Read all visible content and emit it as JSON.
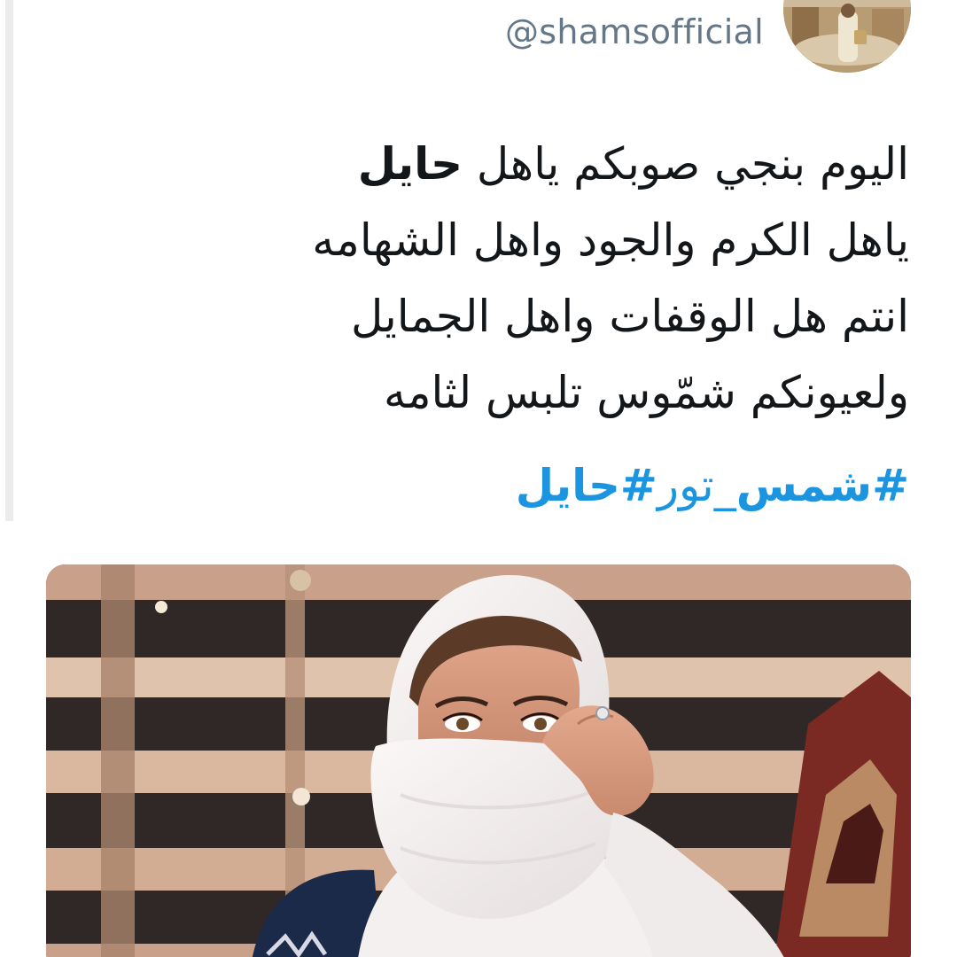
{
  "tweet": {
    "handle": "@shamsofficial",
    "lines": [
      {
        "pre": "اليوم بنجي صوبكم ياهل ",
        "bold": "حايل"
      },
      {
        "pre": "ياهل الكرم والجود واهل الشهامه",
        "bold": ""
      },
      {
        "pre": "انتم هل الوقفات واهل الجمايل",
        "bold": ""
      },
      {
        "pre": "ولعيونكم شمّوس تلبس لثامه",
        "bold": ""
      }
    ],
    "hashtags": [
      {
        "text": "#شمس_تور",
        "bold_part": "#شمس",
        "rest": "_تور"
      },
      {
        "text": "#حايل"
      }
    ]
  },
  "colors": {
    "text": "#14171a",
    "handle": "#657786",
    "link": "#1b95e0"
  },
  "icons": {
    "avatar": "profile-photo",
    "media": "tweet-photo"
  }
}
